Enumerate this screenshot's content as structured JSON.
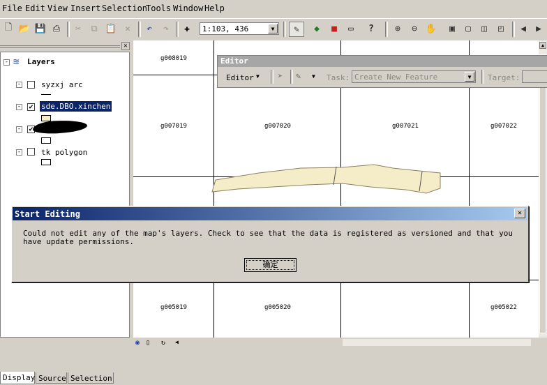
{
  "menu": [
    "File",
    "Edit",
    "View",
    "Insert",
    "Selection",
    "Tools",
    "Window",
    "Help"
  ],
  "toolbar": {
    "scale_value": "1:103, 436",
    "icons": [
      "new-icon",
      "open-icon",
      "save-icon",
      "print-icon",
      "cut-icon",
      "copy-icon",
      "paste-icon",
      "delete-icon",
      "undo-icon",
      "redo-icon",
      "add-data-icon",
      "editor-toolbar-icon",
      "arctoolbox-icon",
      "catalog-icon",
      "window-icon",
      "whats-this-icon",
      "zoom-in-icon",
      "zoom-out-icon",
      "pan-icon",
      "full-extent-icon"
    ]
  },
  "toc": {
    "root_label": "Layers",
    "layers": [
      {
        "name": "syzxj arc",
        "checked": false,
        "selected": false
      },
      {
        "name": "sde.DBO.xinchen",
        "checked": true,
        "selected": true
      },
      {
        "name": "",
        "checked": true,
        "selected": false
      },
      {
        "name": "tk polygon",
        "checked": false,
        "selected": false
      }
    ],
    "tabs": [
      "Display",
      "Source",
      "Selection"
    ]
  },
  "map": {
    "grid_labels": [
      "g008019",
      "g007019",
      "g007020",
      "g007021",
      "g007022",
      "g005019",
      "g005020",
      "g005022"
    ],
    "feature_color": "#f5ecc8"
  },
  "editor_toolbar": {
    "title": "Editor",
    "menu_label": "Editor",
    "task_label": "Task:",
    "task_value": "Create New Feature",
    "target_label": "Target:"
  },
  "dialog": {
    "title": "Start Editing",
    "message": "Could not edit any of the map's layers. Check to see that the data is registered as versioned and that you have update permissions.",
    "ok_label": "确定",
    "close_symbol": "✕"
  }
}
